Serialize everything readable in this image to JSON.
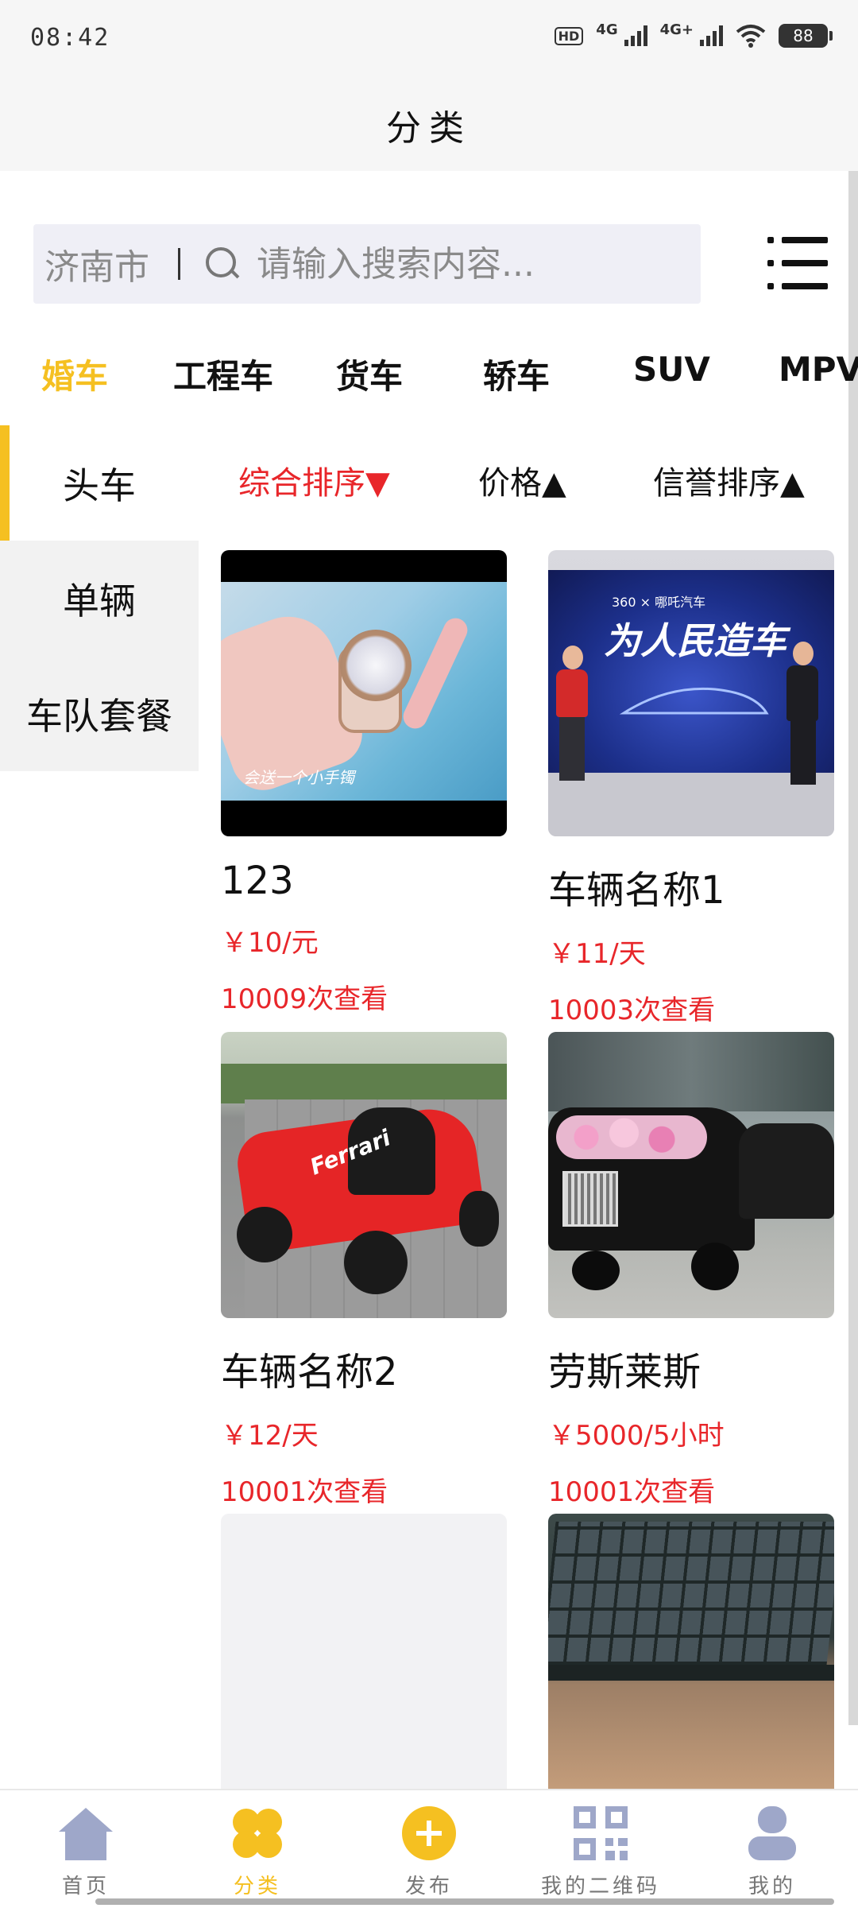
{
  "status_bar": {
    "time": "08:42",
    "hd_label": "HD",
    "network_1": "4G",
    "network_2": "4G+",
    "battery": "88"
  },
  "header": {
    "title": "分类"
  },
  "search": {
    "city": "济南市",
    "placeholder": "请输入搜索内容..."
  },
  "category_tabs": [
    "婚车",
    "工程车",
    "货车",
    "轿车",
    "SUV",
    "MPV"
  ],
  "sub_nav": [
    "头车",
    "单辆",
    "车队套餐"
  ],
  "sort_options": [
    "综合排序▼",
    "价格▲",
    "信誉排序▲"
  ],
  "products": [
    {
      "name": "123",
      "price": "￥10/元",
      "views": "10009次查看",
      "image_text": "会送一个小手镯"
    },
    {
      "name": "车辆名称1",
      "price": "￥11/天",
      "views": "10003次查看",
      "image_text": "为人民造车",
      "image_brand": "360 × 哪吒汽车"
    },
    {
      "name": "车辆名称2",
      "price": "￥12/天",
      "views": "10001次查看",
      "image_text": "Ferrari"
    },
    {
      "name": "劳斯莱斯",
      "price": "￥5000/5小时",
      "views": "10001次查看"
    }
  ],
  "bottom_nav": [
    {
      "label": "首页",
      "icon": "home-icon"
    },
    {
      "label": "分类",
      "icon": "category-icon"
    },
    {
      "label": "发布",
      "icon": "plus-circle-icon"
    },
    {
      "label": "我的二维码",
      "icon": "qr-code-icon"
    },
    {
      "label": "我的",
      "icon": "user-icon"
    }
  ],
  "colors": {
    "accent": "#f5c021",
    "price": "#e8262a",
    "nav_icon": "#9ea7c9"
  }
}
